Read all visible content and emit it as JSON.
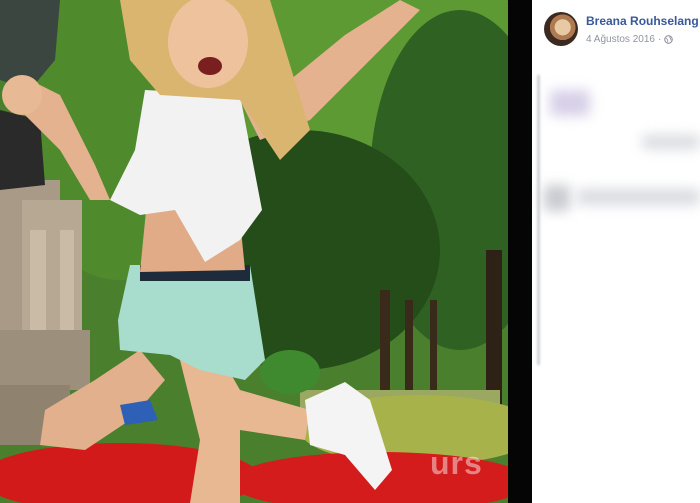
{
  "post": {
    "author_name": "Breana Rouhselang",
    "date": "4 Ağustos 2016",
    "separator": "·",
    "privacy_icon": "globe-icon",
    "avatar_icon": "profile-avatar"
  },
  "photo": {
    "description_icon": "post-photo",
    "watermark": "urs"
  },
  "colors": {
    "author_link": "#385898",
    "meta_text": "#90949c",
    "sidebar_bg": "#ffffff",
    "photo_frame": "#000000"
  }
}
